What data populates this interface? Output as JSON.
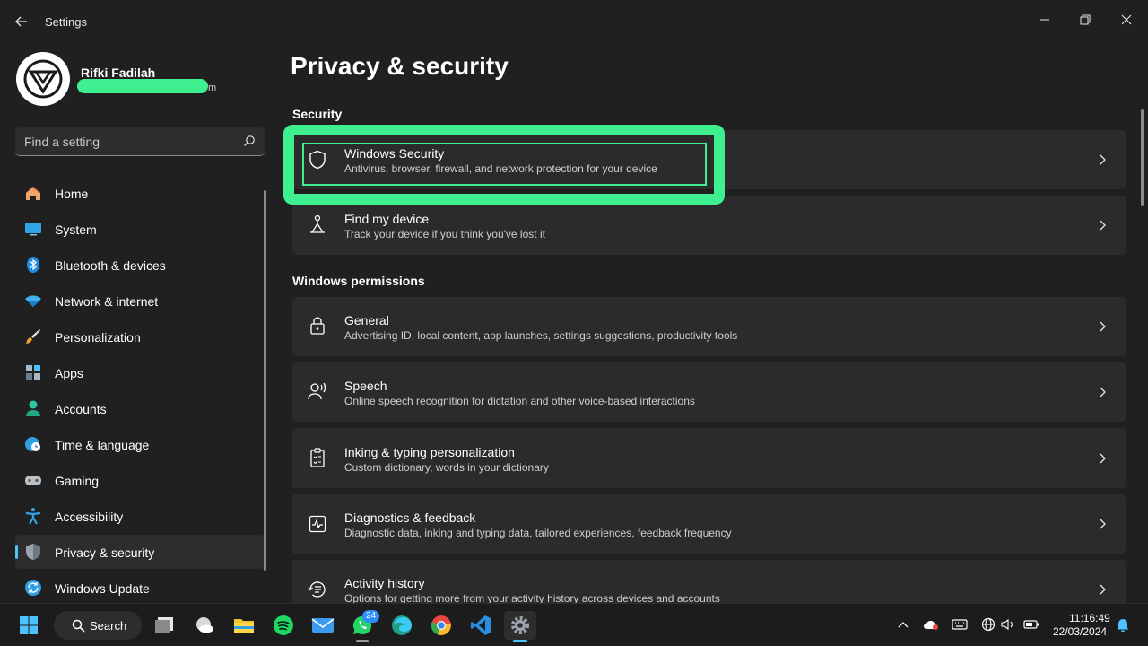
{
  "window": {
    "title": "Settings"
  },
  "profile": {
    "name": "Rifki Fadilah",
    "email_tail": "m"
  },
  "search": {
    "placeholder": "Find a setting"
  },
  "sidebar": {
    "items": [
      {
        "label": "Home",
        "icon": "home-icon"
      },
      {
        "label": "System",
        "icon": "system-icon"
      },
      {
        "label": "Bluetooth & devices",
        "icon": "bluetooth-icon"
      },
      {
        "label": "Network & internet",
        "icon": "wifi-icon"
      },
      {
        "label": "Personalization",
        "icon": "brush-icon"
      },
      {
        "label": "Apps",
        "icon": "apps-icon"
      },
      {
        "label": "Accounts",
        "icon": "person-icon"
      },
      {
        "label": "Time & language",
        "icon": "globe-clock-icon"
      },
      {
        "label": "Gaming",
        "icon": "gamepad-icon"
      },
      {
        "label": "Accessibility",
        "icon": "accessibility-icon"
      },
      {
        "label": "Privacy & security",
        "icon": "shield-icon",
        "selected": true
      },
      {
        "label": "Windows Update",
        "icon": "update-icon"
      }
    ]
  },
  "main": {
    "title": "Privacy & security",
    "sections": [
      {
        "heading": "Security",
        "items": [
          {
            "title": "Windows Security",
            "desc": "Antivirus, browser, firewall, and network protection for your device",
            "icon": "shield-outline-icon"
          },
          {
            "title": "Find my device",
            "desc": "Track your device if you think you've lost it",
            "icon": "find-device-icon"
          }
        ]
      },
      {
        "heading": "Windows permissions",
        "items": [
          {
            "title": "General",
            "desc": "Advertising ID, local content, app launches, settings suggestions, productivity tools",
            "icon": "lock-icon"
          },
          {
            "title": "Speech",
            "desc": "Online speech recognition for dictation and other voice-based interactions",
            "icon": "speech-icon"
          },
          {
            "title": "Inking & typing personalization",
            "desc": "Custom dictionary, words in your dictionary",
            "icon": "clipboard-icon"
          },
          {
            "title": "Diagnostics & feedback",
            "desc": "Diagnostic data, inking and typing data, tailored experiences, feedback frequency",
            "icon": "diagnostics-icon"
          },
          {
            "title": "Activity history",
            "desc": "Options for getting more from your activity history across devices and accounts",
            "icon": "history-icon"
          }
        ]
      }
    ]
  },
  "taskbar": {
    "search_label": "Search",
    "whatsapp_badge": "24",
    "time": "11:16:49",
    "date": "22/03/2024"
  },
  "colors": {
    "highlight": "#3ef08f",
    "accent": "#4cc2ff",
    "background": "#202020",
    "card": "#2b2b2b"
  }
}
